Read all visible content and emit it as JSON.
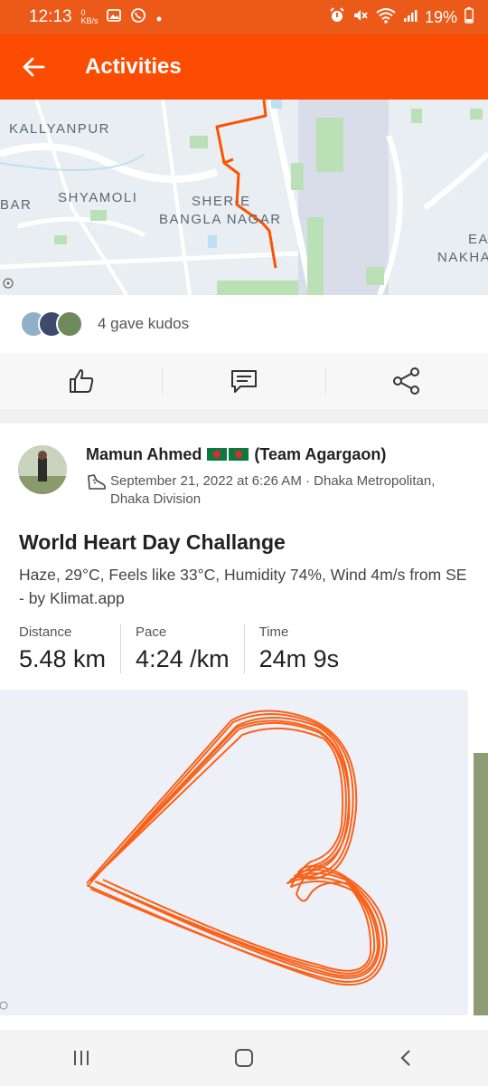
{
  "status_bar": {
    "time": "12:13",
    "speed": "0 KB/s",
    "battery": "19%"
  },
  "app_bar": {
    "title": "Activities"
  },
  "map": {
    "labels": [
      "KALLYANPUR",
      "BAR",
      "SHYAMOLI",
      "SHER-E",
      "BANGLA NAGAR",
      "EA",
      "NAKHA"
    ]
  },
  "kudos": {
    "text": "4 gave kudos"
  },
  "activity": {
    "athlete_name": "Mamun Ahmed",
    "team": "(Team Agargaon)",
    "meta": "September 21, 2022 at 6:26 AM · Dhaka Metropolitan, Dhaka Division",
    "title": "World Heart Day Challange",
    "description": "Haze, 29°C, Feels like 33°C, Humidity 74%, Wind 4m/s from SE - by Klimat.app",
    "stats": [
      {
        "label": "Distance",
        "value": "5.48 km"
      },
      {
        "label": "Pace",
        "value": "4:24 /km"
      },
      {
        "label": "Time",
        "value": "24m 9s"
      }
    ]
  },
  "colors": {
    "brand": "#fc4c02",
    "route": "#fc5200"
  }
}
